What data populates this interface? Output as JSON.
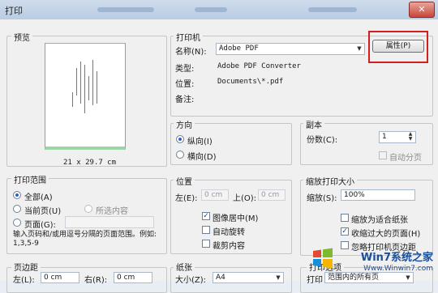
{
  "window": {
    "title": "打印",
    "close_icon": "close-icon"
  },
  "preview": {
    "group_label": "预览",
    "paper_size": "21 x 29.7 cm"
  },
  "printer": {
    "group_label": "打印机",
    "name_label": "名称(N):",
    "name_value": "Adobe PDF",
    "properties_button": "属性(P)",
    "type_label": "类型:",
    "type_value": "Adobe PDF Converter",
    "location_label": "位置:",
    "location_value": "Documents\\*.pdf",
    "comment_label": "备注:"
  },
  "orientation": {
    "group_label": "方向",
    "portrait": "纵向(I)",
    "landscape": "横向(D)",
    "selected": "portrait"
  },
  "copies": {
    "group_label": "副本",
    "count_label": "份数(C):",
    "count_value": "1",
    "collate": "自动分页"
  },
  "print_range": {
    "group_label": "打印范围",
    "all": "全部(A)",
    "current_page": "当前页(U)",
    "selection": "所选内容",
    "pages": "页面(G):",
    "pages_value": "",
    "hint": "输入页码和/或用逗号分隔的页面范围。例如: 1,3,5-9"
  },
  "position": {
    "group_label": "位置",
    "left_label": "左(E):",
    "left_value": "0 cm",
    "top_label": "上(O):",
    "top_value": "0 cm",
    "center": "图像居中(M)",
    "auto_rotate": "自动旋转",
    "crop": "裁剪内容"
  },
  "scaling": {
    "group_label": "缩放打印大小",
    "scale_label": "缩放(S):",
    "scale_value": "100%",
    "fit_paper": "缩放为适合纸张",
    "shrink_oversized": "收缩过大的页面(H)",
    "ignore_margins": "忽略打印机页边距"
  },
  "margins": {
    "group_label": "页边距",
    "left_label": "左(L):",
    "left_value": "0 cm",
    "right_label": "右(R):",
    "right_value": "0 cm"
  },
  "paper": {
    "group_label": "纸张",
    "size_label": "大小(Z):",
    "size_value": "A4"
  },
  "print_options": {
    "group_label": "打印选项",
    "print_label": "打印",
    "print_value": "范围内的所有页"
  },
  "watermark": {
    "brand": "Win7系统之家",
    "url": "Www.Winwin7.com"
  }
}
